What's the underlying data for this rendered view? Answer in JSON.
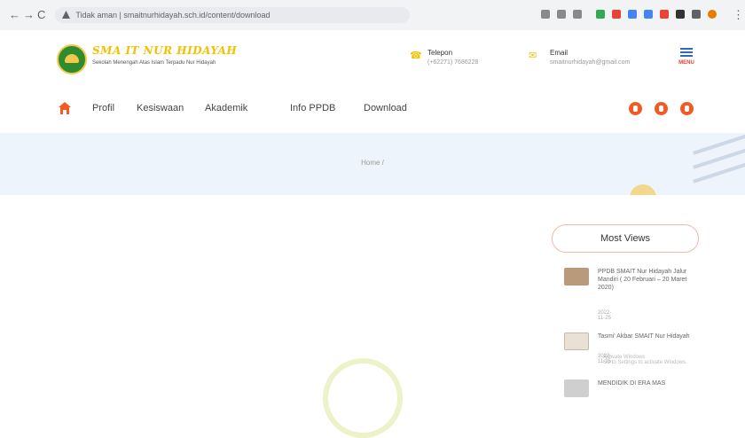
{
  "browser": {
    "back": "←",
    "forward": "→",
    "reload": "C",
    "url_prefix": "Tidak aman |",
    "url": "smaitnurhidayah.sch.id/content/download"
  },
  "header": {
    "school_name": "SMA IT NUR HIDAYAH",
    "school_sub": "Sekolah Menengah Atas Islam Terpadu Nur Hidayah",
    "phone_label": "Telepon",
    "phone_value": "(+62271) 7686228",
    "email_label": "Email",
    "email_value": "smaitnurhidayah@gmail.com",
    "menu_label": "MENU"
  },
  "nav": {
    "items": [
      "Profil",
      "Kesiswaan",
      "Akademik",
      "Info PPDB",
      "Download"
    ]
  },
  "banner": {
    "crumb": "Home /"
  },
  "sidebar": {
    "title": "Most Views",
    "posts": [
      {
        "title": "PPDB SMAIT Nur Hidayah Jalur Mandiri ( 20 Februari – 20 Maret 2020)",
        "date": "2022-11-25"
      },
      {
        "title": "Tasmi' Akbar SMAIT Nur Hidayah",
        "date": "2022-11-25"
      },
      {
        "title": "MENDIDIK DI ERA MAS"
      }
    ],
    "watermark_line1": "Activate Windows",
    "watermark_line2": "Go to Settings to activate Windows."
  }
}
